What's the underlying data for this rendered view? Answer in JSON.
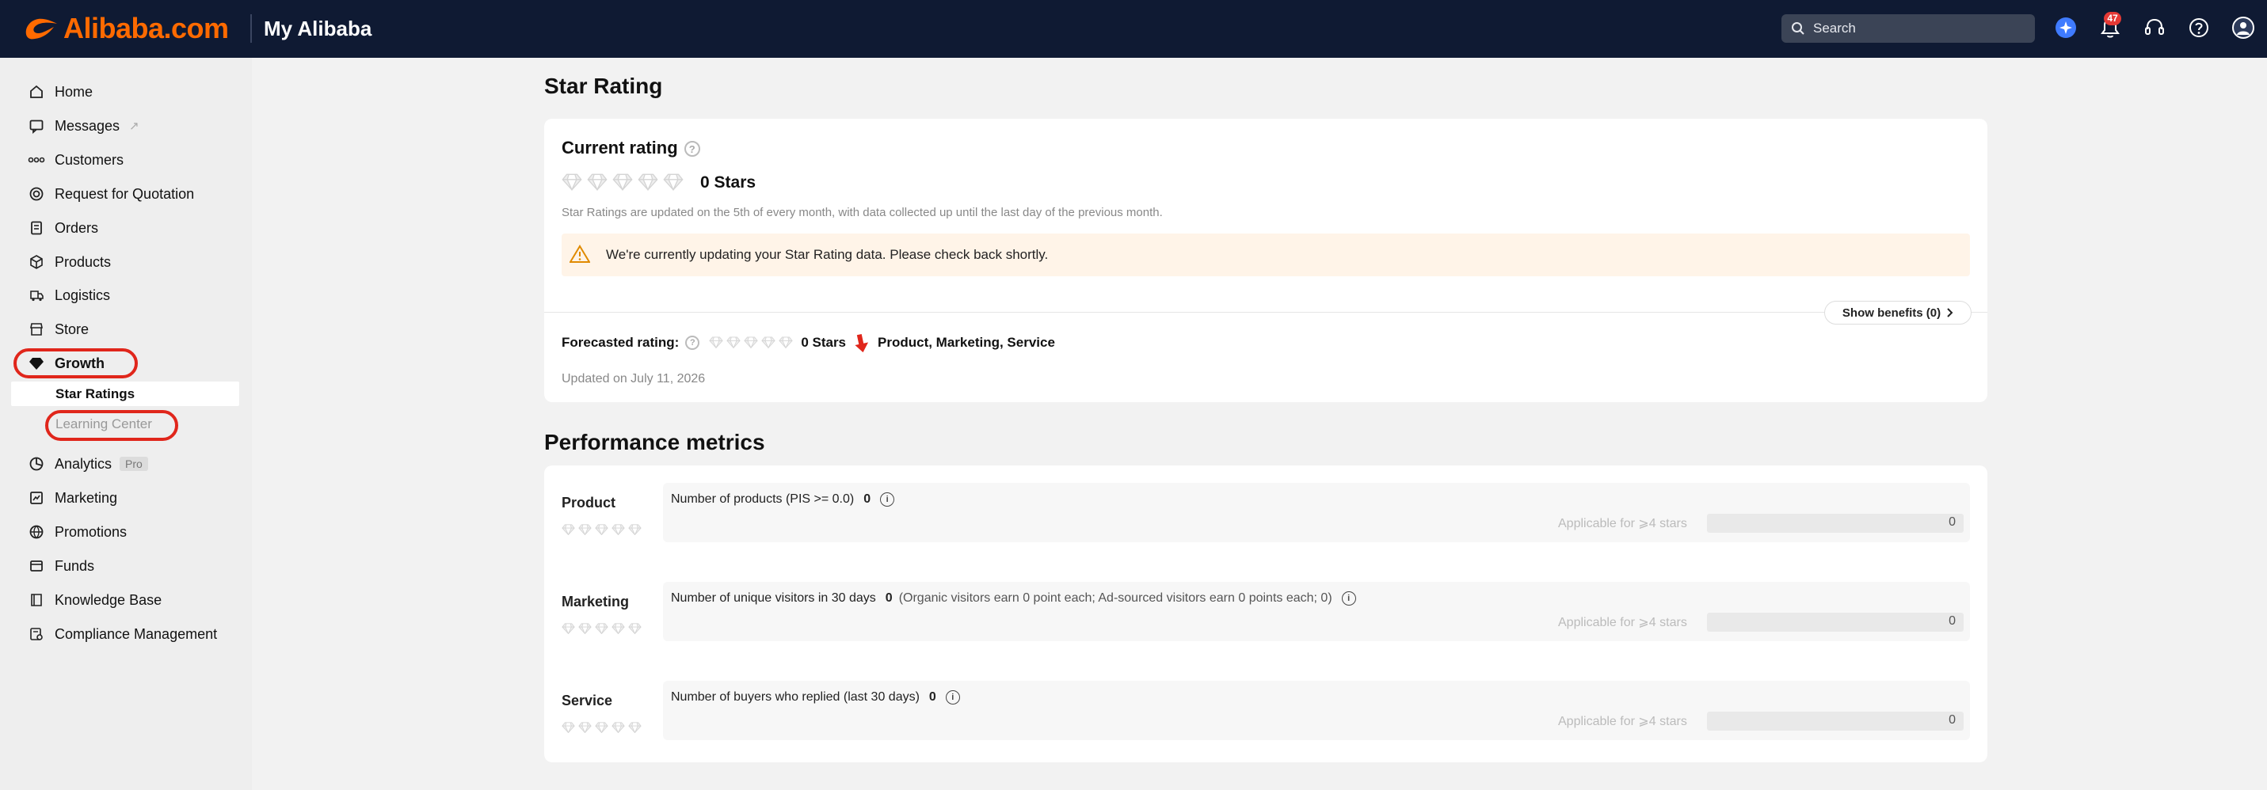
{
  "topbar": {
    "brand": "Alibaba.com",
    "title": "My Alibaba",
    "search_placeholder": "Search",
    "notification_count": "47",
    "accent": "#ff6a00",
    "background": "#0f1a33"
  },
  "sidebar": {
    "items": [
      {
        "label": "Home",
        "icon": "home-icon"
      },
      {
        "label": "Messages",
        "icon": "messages-icon"
      },
      {
        "label": "Customers",
        "icon": "customers-icon"
      },
      {
        "label": "Request for Quotation",
        "icon": "rfq-icon"
      },
      {
        "label": "Orders",
        "icon": "orders-icon"
      },
      {
        "label": "Products",
        "icon": "products-icon"
      },
      {
        "label": "Logistics",
        "icon": "logistics-icon"
      },
      {
        "label": "Store",
        "icon": "store-icon"
      },
      {
        "label": "Growth",
        "icon": "diamond-icon"
      },
      {
        "label": "Analytics",
        "icon": "analytics-icon",
        "badge": "Pro"
      },
      {
        "label": "Marketing",
        "icon": "marketing-icon"
      },
      {
        "label": "Promotions",
        "icon": "promotions-icon"
      },
      {
        "label": "Funds",
        "icon": "funds-icon"
      },
      {
        "label": "Knowledge Base",
        "icon": "knowledge-base-icon"
      },
      {
        "label": "Compliance Management",
        "icon": "compliance-icon"
      }
    ],
    "growth_sub": [
      {
        "label": "Star Ratings",
        "active": true
      },
      {
        "label": "Learning Center",
        "active": false
      }
    ]
  },
  "main": {
    "page_title": "Star Rating",
    "current": {
      "heading": "Current rating",
      "stars_label": "0 Stars",
      "stars_filled": 0,
      "stars_total": 5,
      "note": "Star Ratings are updated on the 5th of every month, with data collected up until the last day of the previous month.",
      "warning": "We're currently updating your Star Rating data. Please check back shortly.",
      "benefits_button": "Show benefits (0)"
    },
    "forecast": {
      "label": "Forecasted rating:",
      "stars_label": "0 Stars",
      "areas": "Product, Marketing, Service",
      "updated": "Updated on July 11, 2026"
    },
    "performance": {
      "title": "Performance metrics",
      "metrics": [
        {
          "name": "Product",
          "label": "Number of products (PIS >= 0.0)",
          "value": "0",
          "note": "",
          "applicable": "Applicable for ⩾4 stars",
          "progress": "0",
          "progress_fraction": 0
        },
        {
          "name": "Marketing",
          "label": "Number of unique visitors in 30 days",
          "value": "0",
          "note": "(Organic visitors earn 0 point each; Ad-sourced visitors earn 0 points each; 0)",
          "applicable": "Applicable for ⩾4 stars",
          "progress": "0",
          "progress_fraction": 0
        },
        {
          "name": "Service",
          "label": "Number of buyers who replied (last 30 days)",
          "value": "0",
          "note": "",
          "applicable": "Applicable for ⩾4 stars",
          "progress": "0",
          "progress_fraction": 0
        }
      ]
    }
  }
}
